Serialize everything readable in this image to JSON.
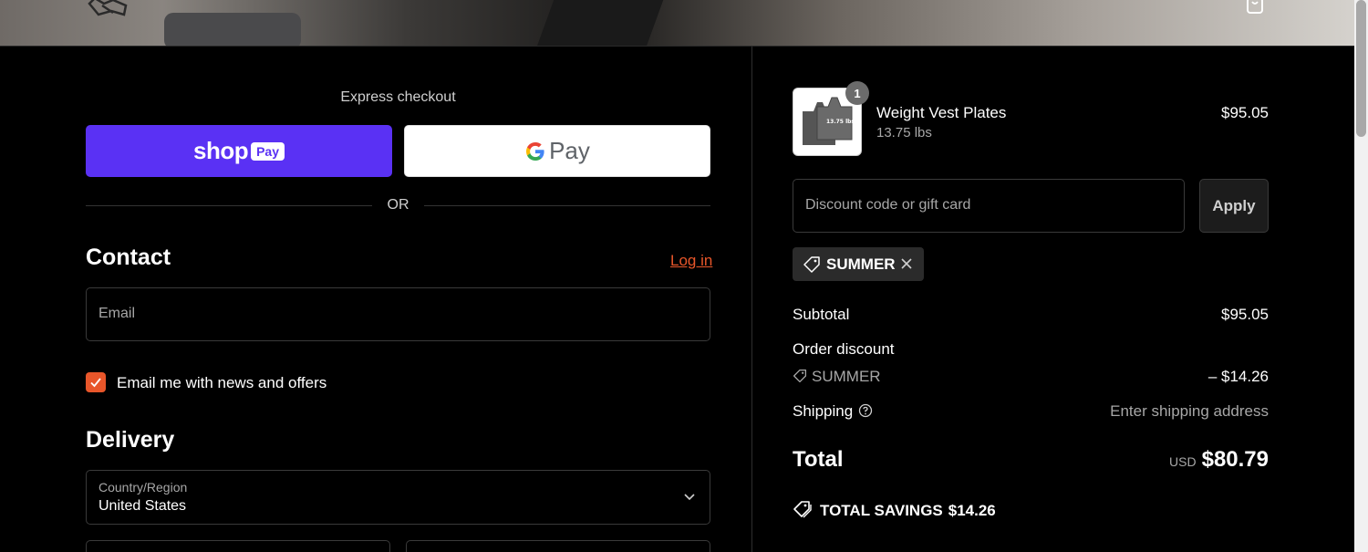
{
  "express": {
    "title": "Express checkout",
    "shop_pay": {
      "brand": "shop",
      "badge": "Pay"
    },
    "google_pay": {
      "label": "Pay"
    },
    "separator": "OR"
  },
  "contact": {
    "title": "Contact",
    "login_link": "Log in",
    "email_placeholder": "Email",
    "newsletter_label": "Email me with news and offers",
    "newsletter_checked": true
  },
  "delivery": {
    "title": "Delivery",
    "country_label": "Country/Region",
    "country_value": "United States"
  },
  "cart": {
    "item": {
      "name": "Weight Vest Plates",
      "variant": "13.75 lbs",
      "price": "$95.05",
      "quantity": "1",
      "thumb_text": "13.75 lbs"
    }
  },
  "discount": {
    "placeholder": "Discount code or gift card",
    "apply_label": "Apply",
    "applied_code": "SUMMER"
  },
  "summary": {
    "subtotal_label": "Subtotal",
    "subtotal_value": "$95.05",
    "order_discount_label": "Order discount",
    "discount_code": "SUMMER",
    "discount_value": "– $14.26",
    "shipping_label": "Shipping",
    "shipping_value": "Enter shipping address",
    "total_label": "Total",
    "currency": "USD",
    "total_value": "$80.79",
    "savings_label": "TOTAL SAVINGS",
    "savings_value": "$14.26"
  },
  "colors": {
    "accent": "#e8562a",
    "shop_pay": "#5a31f4",
    "background": "#000000"
  }
}
